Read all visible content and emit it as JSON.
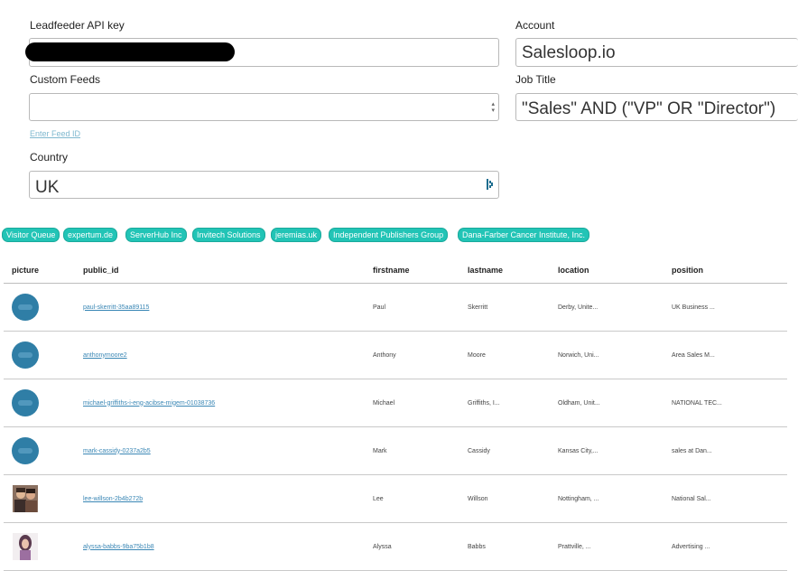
{
  "form": {
    "api_key_label": "Leadfeeder API key",
    "custom_feeds_label": "Custom Feeds",
    "custom_feeds_value": "",
    "enter_feed_link": "Enter Feed ID",
    "country_label": "Country",
    "country_value": "UK",
    "account_label": "Account",
    "account_value": "Salesloop.io",
    "job_title_label": "Job Title",
    "job_title_value": "\"Sales\" AND (\"VP\" OR \"Director\")"
  },
  "tags": [
    "Visitor Queue",
    "expertum.de",
    "ServerHub Inc",
    "Invitech Solutions",
    "jeremias.uk",
    "Independent Publishers Group",
    "Dana-Farber Cancer Institute, Inc."
  ],
  "table": {
    "headers": [
      "picture",
      "public_id",
      "firstname",
      "lastname",
      "location",
      "position"
    ],
    "rows": [
      {
        "avatar": "default-avatar-icon",
        "public_id": "paul-skerritt-35aa89115",
        "firstname": "Paul",
        "lastname": "Skerritt",
        "location": "Derby, Unite...",
        "position": "UK Business ..."
      },
      {
        "avatar": "default-avatar-icon",
        "public_id": "anthonymoore2",
        "firstname": "Anthony",
        "lastname": "Moore",
        "location": "Norwich, Uni...",
        "position": "Area Sales M..."
      },
      {
        "avatar": "default-avatar-icon",
        "public_id": "michael-griffiths-i-eng-acibse-migem-01038736",
        "firstname": "Michael",
        "lastname": "Griffiths, I...",
        "location": "Oldham, Unit...",
        "position": "NATIONAL TEC..."
      },
      {
        "avatar": "default-avatar-icon",
        "public_id": "mark-cassidy-0237a2b5",
        "firstname": "Mark",
        "lastname": "Cassidy",
        "location": "Kansas City,...",
        "position": "sales at Dan..."
      },
      {
        "avatar": "photo-couple",
        "public_id": "lee-willson-2b4b272b",
        "firstname": "Lee",
        "lastname": "Willson",
        "location": "Nottingham, ...",
        "position": "National Sal..."
      },
      {
        "avatar": "photo-woman",
        "public_id": "alyssa-babbs-9ba75b1b8",
        "firstname": "Alyssa",
        "lastname": "Babbs",
        "location": "Prattville, ...",
        "position": "Advertising ..."
      }
    ]
  },
  "colors": {
    "tag_bg": "#22c4b6",
    "link": "#3a87b5",
    "avatar": "#2f7ea6"
  }
}
